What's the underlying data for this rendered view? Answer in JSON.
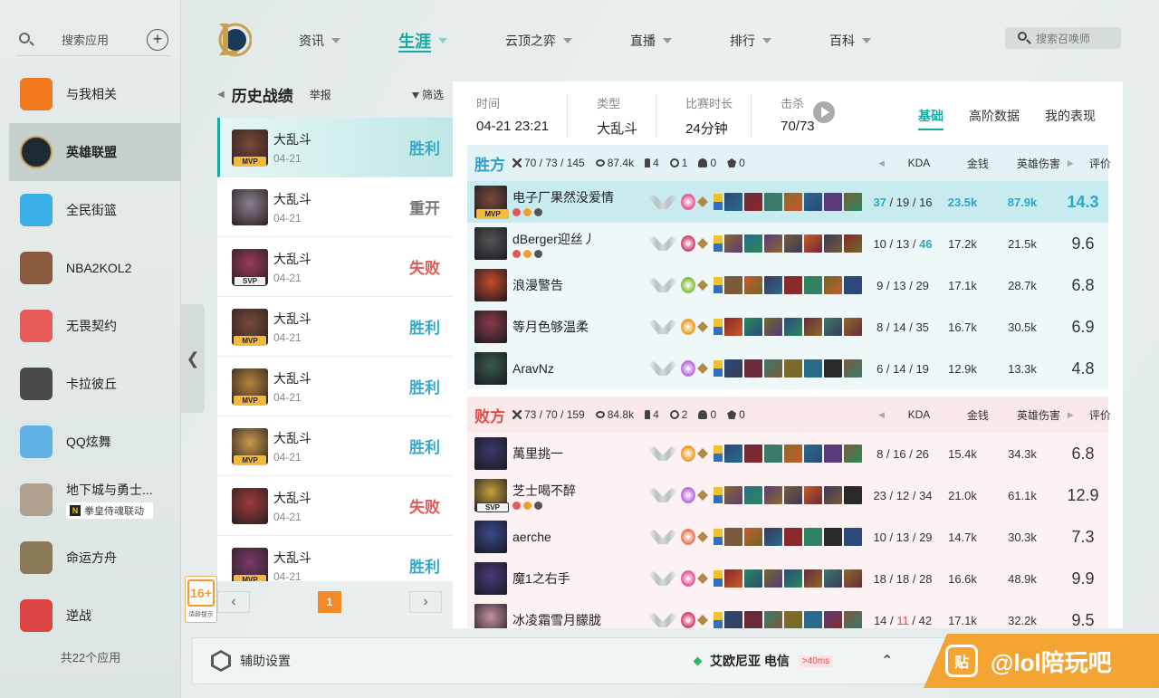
{
  "sidebar": {
    "search_placeholder": "搜索应用",
    "items": [
      {
        "label": "与我相关",
        "icon": "related-icon",
        "color": "#f47a1f"
      },
      {
        "label": "英雄联盟",
        "icon": "lol-icon",
        "color": "#2a2a2a",
        "active": true
      },
      {
        "label": "全民街篮",
        "icon": "basketball-street-icon",
        "color": "#3bb0e8"
      },
      {
        "label": "NBA2KOL2",
        "icon": "nba2k-icon",
        "color": "#8a5a3c"
      },
      {
        "label": "无畏契约",
        "icon": "valorant-icon",
        "color": "#e85a5a"
      },
      {
        "label": "卡拉彼丘",
        "icon": "strinova-icon",
        "color": "#4a4a4a"
      },
      {
        "label": "QQ炫舞",
        "icon": "qq-dance-icon",
        "color": "#5fb2e6"
      },
      {
        "label": "地下城与勇士...",
        "icon": "dnf-icon",
        "color": "#b0a090",
        "tag": "拳皇侍魂联动",
        "tag_letter": "N"
      },
      {
        "label": "命运方舟",
        "icon": "lost-ark-icon",
        "color": "#8a7a5a"
      },
      {
        "label": "逆战",
        "icon": "nizhan-icon",
        "color": "#d44"
      }
    ],
    "count_label": "共22个应用"
  },
  "nav": {
    "items": [
      {
        "label": "资讯",
        "active": false
      },
      {
        "label": "生涯",
        "active": true
      },
      {
        "label": "云顶之弈",
        "active": false
      },
      {
        "label": "直播",
        "active": false
      },
      {
        "label": "排行",
        "active": false
      },
      {
        "label": "百科",
        "active": false
      }
    ],
    "search_placeholder": "搜索召唤师"
  },
  "history": {
    "title": "历史战绩",
    "report": "举报",
    "filter": "筛选",
    "matches": [
      {
        "mode": "大乱斗",
        "date": "04-21",
        "result": "胜利",
        "type": "win",
        "badge": "MVP",
        "color": "#7a4a3a",
        "selected": true
      },
      {
        "mode": "大乱斗",
        "date": "04-21",
        "result": "重开",
        "type": "remake",
        "badge": "",
        "color": "#8a8090"
      },
      {
        "mode": "大乱斗",
        "date": "04-21",
        "result": "失败",
        "type": "loss",
        "badge": "SVP",
        "color": "#9a3a5a"
      },
      {
        "mode": "大乱斗",
        "date": "04-21",
        "result": "胜利",
        "type": "win",
        "badge": "MVP",
        "color": "#7a4a3a"
      },
      {
        "mode": "大乱斗",
        "date": "04-21",
        "result": "胜利",
        "type": "win",
        "badge": "MVP",
        "color": "#b8843a"
      },
      {
        "mode": "大乱斗",
        "date": "04-21",
        "result": "胜利",
        "type": "win",
        "badge": "MVP",
        "color": "#c89a4a"
      },
      {
        "mode": "大乱斗",
        "date": "04-21",
        "result": "失败",
        "type": "loss",
        "badge": "",
        "color": "#a03a3a"
      },
      {
        "mode": "大乱斗",
        "date": "04-21",
        "result": "胜利",
        "type": "win",
        "badge": "MVP",
        "color": "#7a3a6a"
      }
    ],
    "page": "1"
  },
  "age_rating": {
    "age": "16+",
    "tip": "适龄提示"
  },
  "detail": {
    "meta": [
      {
        "k": "时间",
        "v": "04-21 23:21"
      },
      {
        "k": "类型",
        "v": "大乱斗"
      },
      {
        "k": "比赛时长",
        "v": "24分钟"
      },
      {
        "k": "击杀",
        "v": "70/73"
      }
    ],
    "tabs": [
      {
        "label": "基础",
        "active": true
      },
      {
        "label": "高阶数据",
        "active": false
      },
      {
        "label": "我的表现",
        "active": false
      }
    ],
    "columns": {
      "kda": "KDA",
      "gold": "金钱",
      "damage": "英雄伤害",
      "score": "评价"
    },
    "win_team": {
      "name": "胜方",
      "kills": "70 / 73 / 145",
      "gold": "87.4k",
      "towers": "4",
      "inhib": "1",
      "baron": "0",
      "dragon": "0",
      "players": [
        {
          "name": "电子厂果然没爱情",
          "kda_k": "37",
          "kda_d": "19",
          "kda_a": "16",
          "gold": "23.5k",
          "dmg": "87.9k",
          "score": "14.3",
          "me": true,
          "color": "#7a4a3a"
        },
        {
          "name": "dBerger迎丝丿",
          "kda_k": "10",
          "kda_d": "13",
          "kda_a": "46",
          "gold": "17.2k",
          "dmg": "21.5k",
          "score": "9.6",
          "color": "#555"
        },
        {
          "name": "浪漫警告",
          "kda_k": "9",
          "kda_d": "13",
          "kda_a": "29",
          "gold": "17.1k",
          "dmg": "28.7k",
          "score": "6.8",
          "color": "#c84a2a"
        },
        {
          "name": "等月色够温柔",
          "kda_k": "8",
          "kda_d": "14",
          "kda_a": "35",
          "gold": "16.7k",
          "dmg": "30.5k",
          "score": "6.9",
          "color": "#8a3a4a"
        },
        {
          "name": "AravNz",
          "kda_k": "6",
          "kda_d": "14",
          "kda_a": "19",
          "gold": "12.9k",
          "dmg": "13.3k",
          "score": "4.8",
          "color": "#3a5a4a"
        }
      ]
    },
    "loss_team": {
      "name": "败方",
      "kills": "73 / 70 / 159",
      "gold": "84.8k",
      "towers": "4",
      "inhib": "2",
      "baron": "0",
      "dragon": "0",
      "players": [
        {
          "name": "萬里挑一",
          "kda_k": "8",
          "kda_d": "16",
          "kda_a": "26",
          "gold": "15.4k",
          "dmg": "34.3k",
          "score": "6.8",
          "color": "#3a3a6a"
        },
        {
          "name": "芝士喝不醉",
          "kda_k": "23",
          "kda_d": "12",
          "kda_a": "34",
          "gold": "21.0k",
          "dmg": "61.1k",
          "score": "12.9",
          "badge": "SVP",
          "color": "#c8a03a"
        },
        {
          "name": "aerche",
          "kda_k": "10",
          "kda_d": "13",
          "kda_a": "29",
          "gold": "14.7k",
          "dmg": "30.3k",
          "score": "7.3",
          "color": "#3a4a8a"
        },
        {
          "name": "魔1之右手",
          "kda_k": "18",
          "kda_d": "18",
          "kda_a": "28",
          "gold": "16.6k",
          "dmg": "48.9k",
          "score": "9.9",
          "color": "#4a3a7a"
        },
        {
          "name": "冰凌霜雪月朦胧",
          "kda_k": "14",
          "kda_d": "11",
          "kda_a": "42",
          "gold": "17.1k",
          "dmg": "32.2k",
          "score": "9.5",
          "color": "#c890a0"
        }
      ]
    }
  },
  "bottom": {
    "assist": "辅助设置",
    "server": "艾欧尼亚 电信",
    "ping": ">40ms",
    "watermark": "@lol陪玩吧",
    "watermark_char": "贴"
  },
  "colors": {
    "accent": "#19a9a0",
    "win": "#35a9c7",
    "loss": "#e05a5a",
    "orange": "#f48a25"
  }
}
